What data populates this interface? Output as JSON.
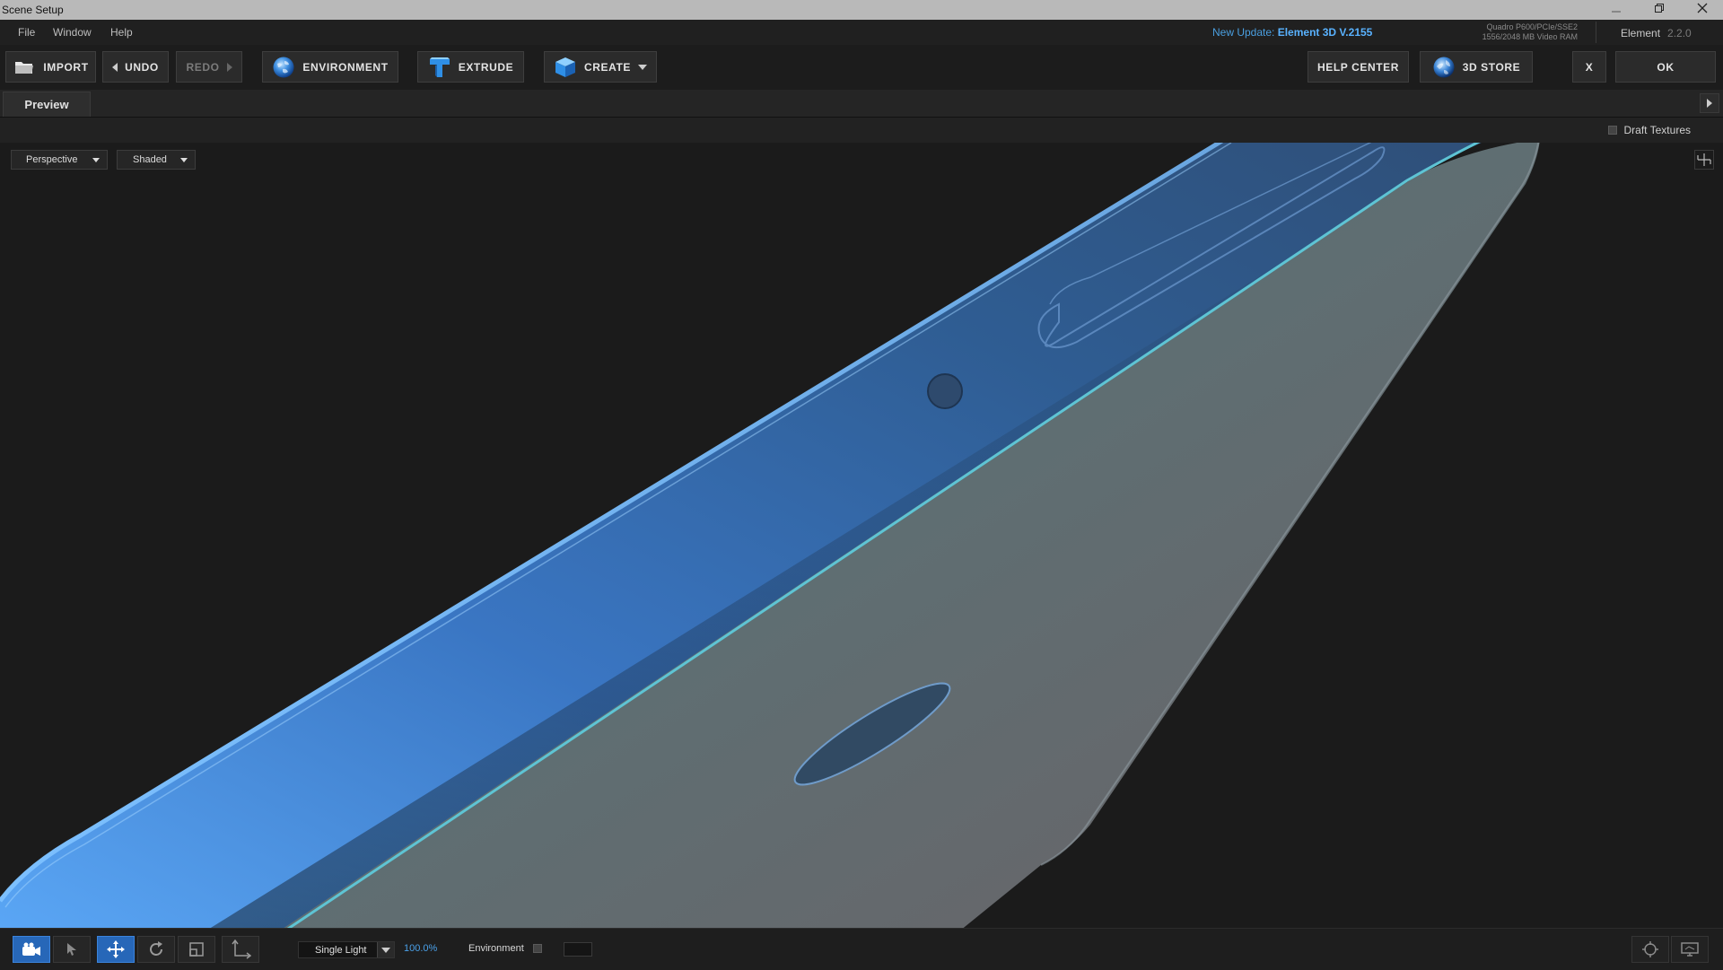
{
  "window": {
    "title": "Scene Setup"
  },
  "menu": [
    "File",
    "Window",
    "Help"
  ],
  "update": {
    "prefix": "New Update:",
    "name": "Element 3D V.2155"
  },
  "gpu": {
    "name": "Quadro P600/PCIe/SSE2",
    "ram": "1556/2048 MB Video RAM"
  },
  "product": {
    "name": "Element",
    "version": "2.2.0"
  },
  "toolbar": {
    "import": "IMPORT",
    "undo": "UNDO",
    "redo": "REDO",
    "environment": "ENVIRONMENT",
    "extrude": "EXTRUDE",
    "create": "CREATE",
    "help_center": "HELP CENTER",
    "store": "3D STORE",
    "cancel": "X",
    "ok": "OK"
  },
  "tabs": [
    "Preview"
  ],
  "viewport": {
    "draft_textures": "Draft Textures",
    "camera_view": "Perspective",
    "shading_mode": "Shaded"
  },
  "bottom": {
    "light_mode": "Single Light",
    "light_intensity": "100.0%",
    "environment_label": "Environment"
  },
  "colors": {
    "accent": "#2767b8",
    "link": "#4aa0e8",
    "model_blue": "#3f7fd0",
    "rim_highlight": "#5ec4d4"
  },
  "icons": {
    "import": "folder-icon",
    "environment": "globe-icon",
    "extrude": "extrude-t-icon",
    "create": "cube-icon",
    "store": "earth-icon"
  }
}
